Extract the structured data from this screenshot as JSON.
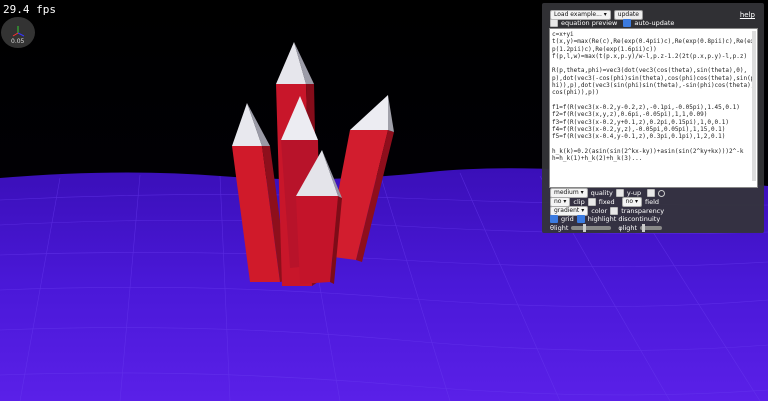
{
  "hud": {
    "fps": "29.4 fps",
    "gizmo_value": "0.05"
  },
  "panel": {
    "example_select": "Load example...",
    "update_label": "update",
    "help_label": "help",
    "equation_preview_label": "equation preview",
    "auto_update_label": "auto-update",
    "code": "c=x+yi\nt(x,y)=max(Re(c),Re(exp(0.4pii)c),Re(exp(0.8pii)c),Re(exp(1.2pii)c),Re(exp(1.6pii)c))\nf(p,l,w)=max(t(p.x,p.y)/w-l,p.z-1.2(2t(p.x,p.y)-l,p.z)\n\nR(p,theta,phi)=vec3(dot(vec3(cos(theta),sin(theta),0),p),dot(vec3(-cos(phi)sin(theta),cos(phi)cos(theta),sin(phi)),p),dot(vec3(sin(phi)sin(theta),-sin(phi)cos(theta),cos(phi)),p))\n\nf1=f(R(vec3(x-0.2,y-0.2,z),-0.1pi,-0.05pi),1.45,0.1)\nf2=f(R(vec3(x,y,z),0.6pi,-0.05pi),1,1,0.09)\nf3=f(R(vec3(x-0.2,y+0.1,z),0.2pi,0.15pi),1,0,0.1)\nf4=f(R(vec3(x-0.2,y,z),-0.05pi,0.05pi),1,15,0.1)\nf5=f(R(vec3(x-0.4,y-0.1,z),0.3pi,0.1pi),1,2,0.1)\n\nh_k(k)=0.2(asin(sin(2^kx-ky))+asin(sin(2^ky+kx)))2^-k\nh=h_k(1)+h_k(2)+h_k(3)...",
    "quality_select": "medium",
    "quality_label": "quality",
    "y_up_label": "y-up",
    "clip_select": "no",
    "clip_label": "clip",
    "fixed_label": "fixed",
    "field_select": "no",
    "field_label": "field",
    "color_select": "gradient",
    "color_label": "color",
    "transparency_label": "transparency",
    "grid_label": "grid",
    "highlight_label": "highlight discontinuity",
    "theta_label": "θlight",
    "phi_label": "φlight"
  }
}
